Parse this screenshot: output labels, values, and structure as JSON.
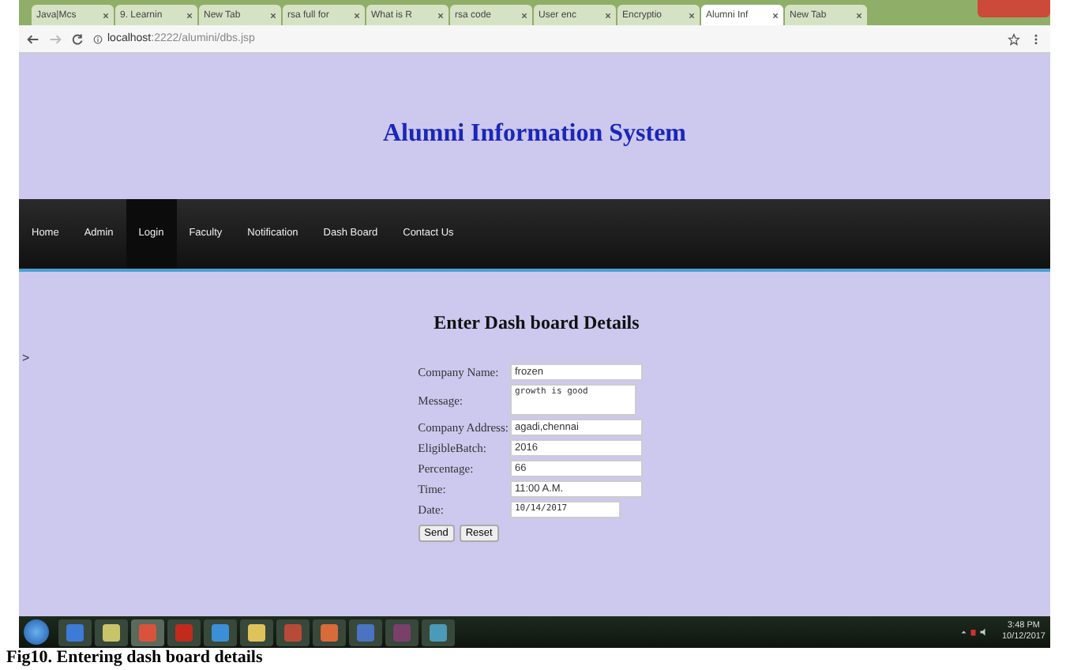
{
  "browser": {
    "tabs": [
      {
        "label": "Java|Mcs",
        "selected": false
      },
      {
        "label": "9. Learnin",
        "selected": false
      },
      {
        "label": "New Tab",
        "selected": false
      },
      {
        "label": "rsa full for",
        "selected": false
      },
      {
        "label": "What is R",
        "selected": false
      },
      {
        "label": "rsa code",
        "selected": false
      },
      {
        "label": "User enc",
        "selected": false
      },
      {
        "label": "Encryptio",
        "selected": false
      },
      {
        "label": "Alumni Inf",
        "selected": true
      },
      {
        "label": "New Tab",
        "selected": false
      }
    ],
    "url_host": "localhost",
    "url_path": ":2222/alumini/dbs.jsp"
  },
  "page": {
    "title": "Alumni Information System",
    "nav": [
      {
        "label": "Home",
        "selected": false
      },
      {
        "label": "Admin",
        "selected": false
      },
      {
        "label": "Login",
        "selected": true
      },
      {
        "label": "Faculty",
        "selected": false
      },
      {
        "label": "Notification",
        "selected": false
      },
      {
        "label": "Dash Board",
        "selected": false
      },
      {
        "label": "Contact Us",
        "selected": false
      }
    ],
    "side_marker": ">",
    "form": {
      "heading": "Enter Dash board Details",
      "fields": [
        {
          "label": "Company Name:",
          "value": "frozen",
          "kind": "text"
        },
        {
          "label": "Message:",
          "value": "growth is good",
          "kind": "textarea"
        },
        {
          "label": "Company Address:",
          "value": "agadi,chennai",
          "kind": "text"
        },
        {
          "label": "EligibleBatch:",
          "value": "2016",
          "kind": "text"
        },
        {
          "label": "Percentage:",
          "value": "66",
          "kind": "text"
        },
        {
          "label": "Time:",
          "value": "11:00 A.M.",
          "kind": "text"
        },
        {
          "label": "Date:",
          "value": "10/14/2017",
          "kind": "date"
        }
      ],
      "buttons": [
        "Send",
        "Reset"
      ]
    }
  },
  "taskbar": {
    "time": "3:48 PM",
    "date": "10/12/2017"
  },
  "caption": "Fig10. Entering dash board details"
}
